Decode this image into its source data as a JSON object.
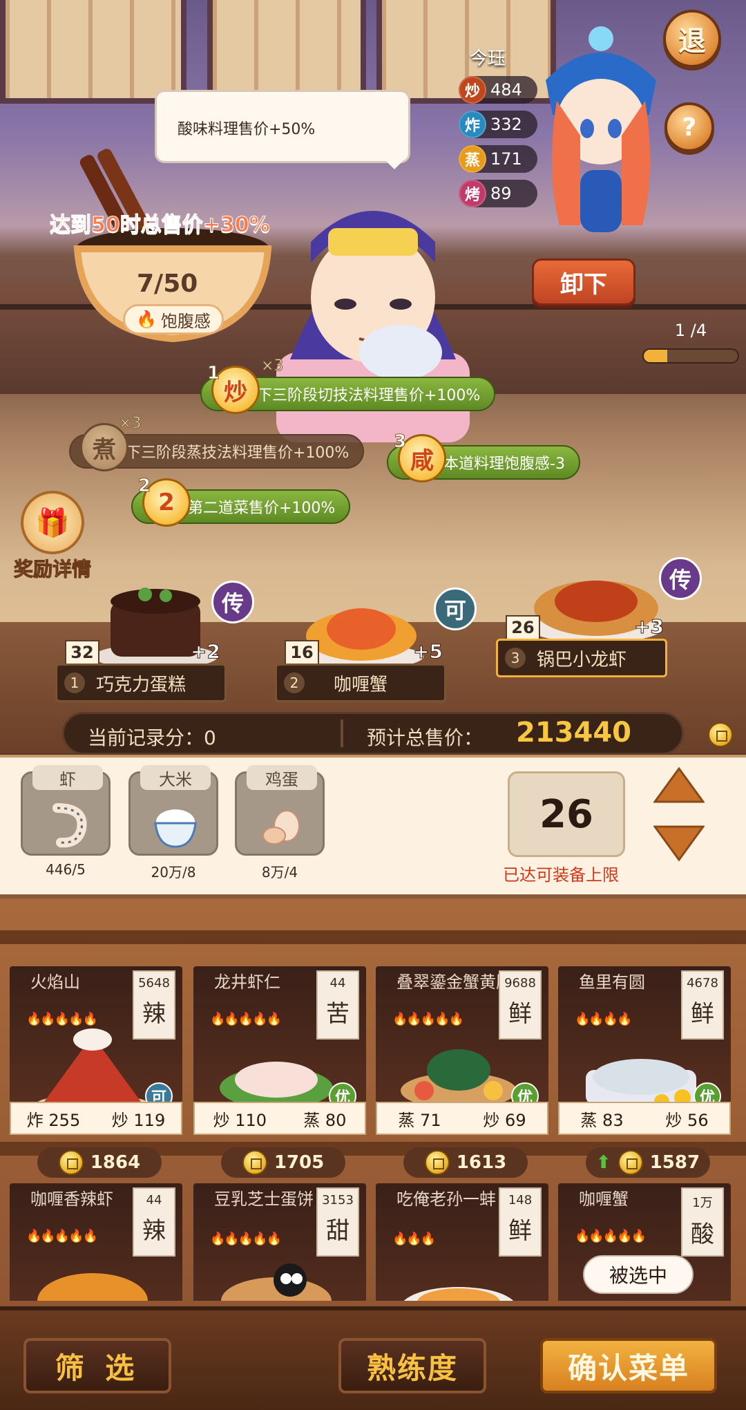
{
  "top_buttons": {
    "exit": "退",
    "help": "?"
  },
  "character": {
    "name": "今珏",
    "stats": [
      {
        "icon": "炒",
        "value": "484",
        "color": "#c2461c"
      },
      {
        "icon": "炸",
        "value": "332",
        "color": "#2a8ac0"
      },
      {
        "icon": "蒸",
        "value": "171",
        "color": "#e89a1a"
      },
      {
        "icon": "烤",
        "value": "89",
        "color": "#c03a6a"
      }
    ]
  },
  "speech": "酸味料理售价+50%",
  "bowl": {
    "bonus": "达到50时总售价+30%",
    "progress": "7/50",
    "progress_fraction": 0.14,
    "label": "饱腹感"
  },
  "unload_label": "卸下",
  "page_indicator": "1 /4",
  "page_fraction": 0.25,
  "buffs": [
    {
      "num": "1",
      "coin": "炒",
      "mult": "×3",
      "text": "下三阶段切技法料理售价+100%",
      "style": "green"
    },
    {
      "num": "",
      "coin": "煮",
      "mult": "×3",
      "text": "下三阶段蒸技法料理售价+100%",
      "style": "dim"
    },
    {
      "num": "3",
      "coin": "咸",
      "mult": "",
      "text": "本道料理饱腹感-3",
      "style": "green"
    },
    {
      "num": "2",
      "coin": "2",
      "mult": "",
      "text": "第二道菜售价+100%",
      "style": "green"
    }
  ],
  "reward_label": "奖励详情",
  "slots": [
    {
      "index": "1",
      "name": "巧克力蛋糕",
      "qty": "32",
      "plus": "+2",
      "badge": "传"
    },
    {
      "index": "2",
      "name": "咖喱蟹",
      "qty": "16",
      "plus": "+5",
      "badge": "可"
    },
    {
      "index": "3",
      "name": "锅巴小龙虾",
      "qty": "26",
      "plus": "+3",
      "badge": "传"
    }
  ],
  "score": {
    "current_label": "当前记录分：",
    "current_value": "0",
    "total_label": "预计总售价：",
    "total_value": "213440"
  },
  "ingredients": [
    {
      "name": "虾",
      "count": "446/5"
    },
    {
      "name": "大米",
      "count": "20万/8"
    },
    {
      "name": "鸡蛋",
      "count": "8万/4"
    }
  ],
  "equip_count": "26",
  "limit_text": "已达可装备上限",
  "recipes": [
    {
      "name": "火焰山",
      "price": "5648",
      "taste": "辣",
      "flames": "🔥🔥🔥🔥🔥",
      "quality": "可",
      "s1": "炸",
      "v1": "255",
      "s2": "炒",
      "v2": "119",
      "cost": "1864"
    },
    {
      "name": "龙井虾仁",
      "price": "44",
      "taste": "苦",
      "flames": "🔥🔥🔥🔥🔥",
      "quality": "优",
      "s1": "炒",
      "v1": "110",
      "s2": "蒸",
      "v2": "80",
      "cost": "1705"
    },
    {
      "name": "叠翠鎏金蟹黄肥",
      "price": "9688",
      "taste": "鲜",
      "flames": "🔥🔥🔥🔥🔥",
      "quality": "优",
      "s1": "蒸",
      "v1": "71",
      "s2": "炒",
      "v2": "69",
      "cost": "1613"
    },
    {
      "name": "鱼里有圆",
      "price": "4678",
      "taste": "鲜",
      "flames": "🔥🔥🔥🔥",
      "quality": "优",
      "s1": "蒸",
      "v1": "83",
      "s2": "炒",
      "v2": "56",
      "cost": "1587"
    },
    {
      "name": "咖喱香辣虾",
      "price": "44",
      "taste": "辣",
      "flames": "🔥🔥🔥🔥🔥"
    },
    {
      "name": "豆乳芝士蛋饼",
      "price": "3153",
      "taste": "甜",
      "flames": "🔥🔥🔥🔥🔥"
    },
    {
      "name": "吃俺老孙一蚌",
      "price": "148",
      "taste": "鲜",
      "flames": "🔥🔥🔥"
    },
    {
      "name": "咖喱蟹",
      "price": "1万",
      "taste": "酸",
      "flames": "🔥🔥🔥🔥🔥"
    }
  ],
  "selected_label": "被选中",
  "bottom": {
    "filter": "筛 选",
    "proficiency": "熟练度",
    "confirm": "确认菜单"
  }
}
